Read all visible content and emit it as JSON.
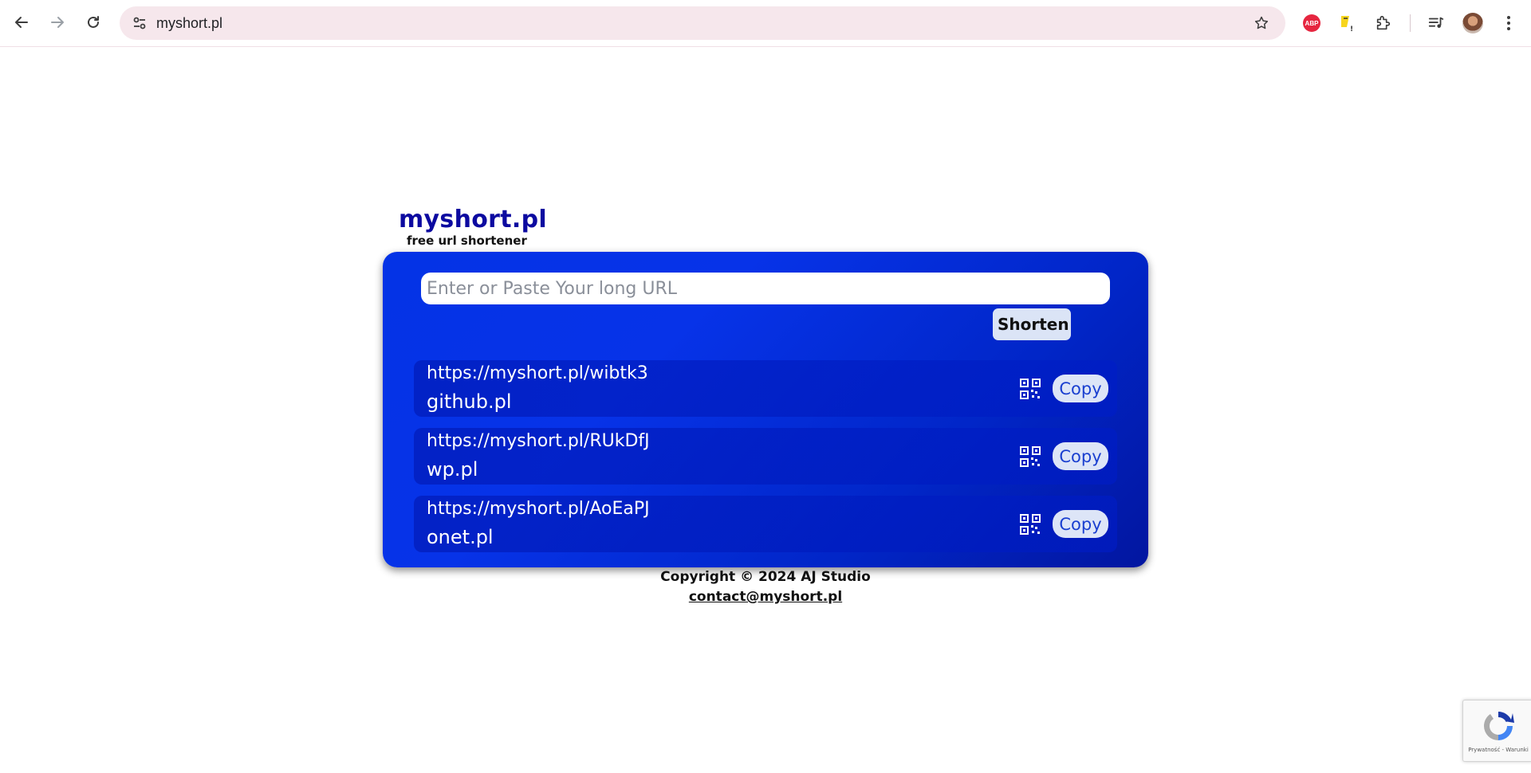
{
  "browser": {
    "address_bar": "myshort.pl"
  },
  "page": {
    "title": "myshort.pl",
    "tagline": "free url shortener",
    "input_placeholder": "Enter or Paste Your long URL",
    "shorten_label": "Shorten",
    "links": [
      {
        "short": "https://myshort.pl/wibtk3",
        "original": "github.pl",
        "copy_label": "Copy"
      },
      {
        "short": "https://myshort.pl/RUkDfJ",
        "original": "wp.pl",
        "copy_label": "Copy"
      },
      {
        "short": "https://myshort.pl/AoEaPJ",
        "original": "onet.pl",
        "copy_label": "Copy"
      }
    ],
    "footer_copyright": "Copyright © 2024 AJ Studio",
    "footer_email": "contact@myshort.pl"
  },
  "recaptcha": {
    "terms_text": "Prywatność - Warunki"
  },
  "icons": [
    "back-icon",
    "forward-icon",
    "reload-icon",
    "site-info-icon",
    "bookmark-star-icon",
    "adblock-plus-icon",
    "extension-icon",
    "puzzle-icon",
    "media-playlist-icon",
    "profile-avatar",
    "more-menu-icon",
    "qr-code-icon",
    "recaptcha-icon"
  ],
  "colors": {
    "brand_title": "#0c0aa0",
    "card_gradient_start": "#0433e6",
    "card_gradient_end": "#0216a0",
    "button_bg": "#dbe4f6",
    "copy_text": "#1a3fd0"
  }
}
